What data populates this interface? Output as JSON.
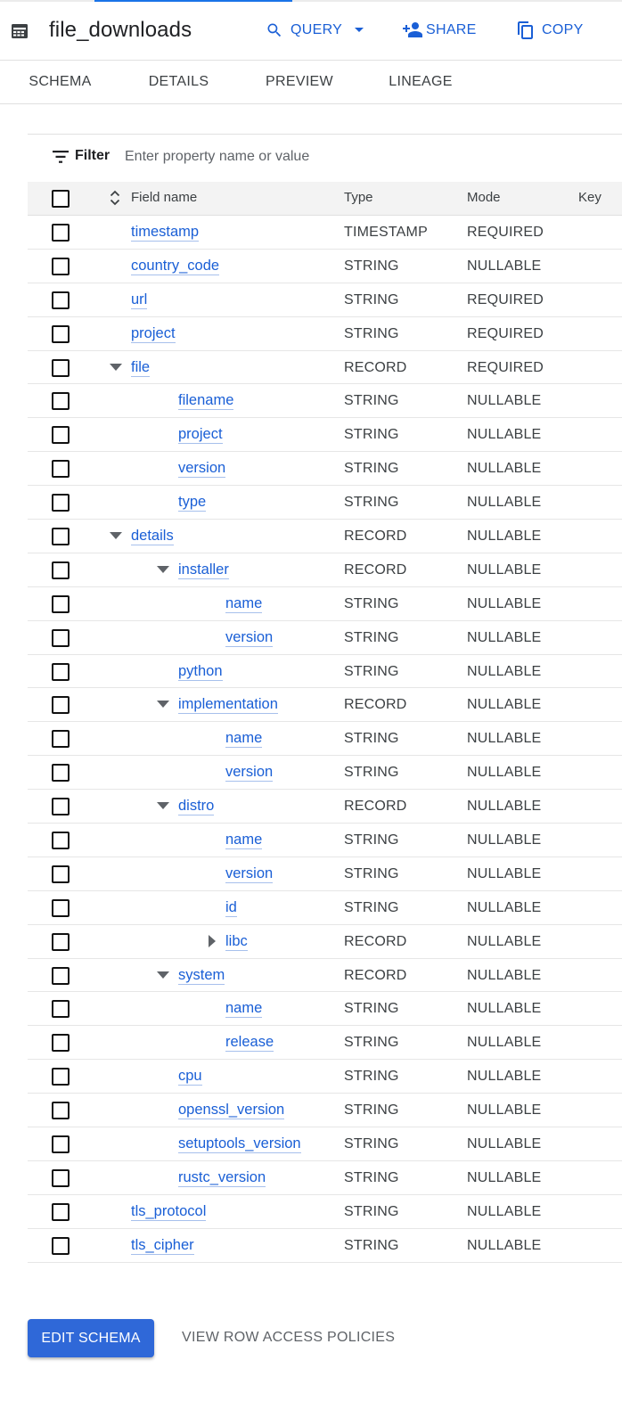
{
  "window": {
    "title": "file_downloads",
    "title_icon": "table-icon"
  },
  "toolbar": {
    "query_label": "QUERY",
    "query_icon": "search-icon",
    "share_label": "SHARE",
    "share_icon": "person-add-icon",
    "copy_label": "COPY",
    "copy_icon": "copy-icon"
  },
  "tabs": [
    {
      "label": "SCHEMA",
      "active": true
    },
    {
      "label": "DETAILS",
      "active": false
    },
    {
      "label": "PREVIEW",
      "active": false
    },
    {
      "label": "LINEAGE",
      "active": false
    }
  ],
  "filter": {
    "label": "Filter",
    "placeholder": "Enter property name or value",
    "value": ""
  },
  "table": {
    "headers": {
      "field_name": "Field name",
      "type": "Type",
      "mode": "Mode",
      "key": "Key"
    },
    "rows": [
      {
        "name": "timestamp",
        "type": "TIMESTAMP",
        "mode": "REQUIRED",
        "level": 0,
        "expander": "none"
      },
      {
        "name": "country_code",
        "type": "STRING",
        "mode": "NULLABLE",
        "level": 0,
        "expander": "none"
      },
      {
        "name": "url",
        "type": "STRING",
        "mode": "REQUIRED",
        "level": 0,
        "expander": "none"
      },
      {
        "name": "project",
        "type": "STRING",
        "mode": "REQUIRED",
        "level": 0,
        "expander": "none"
      },
      {
        "name": "file",
        "type": "RECORD",
        "mode": "REQUIRED",
        "level": 0,
        "expander": "expanded"
      },
      {
        "name": "filename",
        "type": "STRING",
        "mode": "NULLABLE",
        "level": 1,
        "expander": "none"
      },
      {
        "name": "project",
        "type": "STRING",
        "mode": "NULLABLE",
        "level": 1,
        "expander": "none"
      },
      {
        "name": "version",
        "type": "STRING",
        "mode": "NULLABLE",
        "level": 1,
        "expander": "none"
      },
      {
        "name": "type",
        "type": "STRING",
        "mode": "NULLABLE",
        "level": 1,
        "expander": "none"
      },
      {
        "name": "details",
        "type": "RECORD",
        "mode": "NULLABLE",
        "level": 0,
        "expander": "expanded"
      },
      {
        "name": "installer",
        "type": "RECORD",
        "mode": "NULLABLE",
        "level": 1,
        "expander": "expanded"
      },
      {
        "name": "name",
        "type": "STRING",
        "mode": "NULLABLE",
        "level": 2,
        "expander": "none"
      },
      {
        "name": "version",
        "type": "STRING",
        "mode": "NULLABLE",
        "level": 2,
        "expander": "none"
      },
      {
        "name": "python",
        "type": "STRING",
        "mode": "NULLABLE",
        "level": 1,
        "expander": "none"
      },
      {
        "name": "implementation",
        "type": "RECORD",
        "mode": "NULLABLE",
        "level": 1,
        "expander": "expanded"
      },
      {
        "name": "name",
        "type": "STRING",
        "mode": "NULLABLE",
        "level": 2,
        "expander": "none"
      },
      {
        "name": "version",
        "type": "STRING",
        "mode": "NULLABLE",
        "level": 2,
        "expander": "none"
      },
      {
        "name": "distro",
        "type": "RECORD",
        "mode": "NULLABLE",
        "level": 1,
        "expander": "expanded"
      },
      {
        "name": "name",
        "type": "STRING",
        "mode": "NULLABLE",
        "level": 2,
        "expander": "none"
      },
      {
        "name": "version",
        "type": "STRING",
        "mode": "NULLABLE",
        "level": 2,
        "expander": "none"
      },
      {
        "name": "id",
        "type": "STRING",
        "mode": "NULLABLE",
        "level": 2,
        "expander": "none"
      },
      {
        "name": "libc",
        "type": "RECORD",
        "mode": "NULLABLE",
        "level": 2,
        "expander": "collapsed"
      },
      {
        "name": "system",
        "type": "RECORD",
        "mode": "NULLABLE",
        "level": 1,
        "expander": "expanded"
      },
      {
        "name": "name",
        "type": "STRING",
        "mode": "NULLABLE",
        "level": 2,
        "expander": "none"
      },
      {
        "name": "release",
        "type": "STRING",
        "mode": "NULLABLE",
        "level": 2,
        "expander": "none"
      },
      {
        "name": "cpu",
        "type": "STRING",
        "mode": "NULLABLE",
        "level": 1,
        "expander": "none"
      },
      {
        "name": "openssl_version",
        "type": "STRING",
        "mode": "NULLABLE",
        "level": 1,
        "expander": "none"
      },
      {
        "name": "setuptools_version",
        "type": "STRING",
        "mode": "NULLABLE",
        "level": 1,
        "expander": "none"
      },
      {
        "name": "rustc_version",
        "type": "STRING",
        "mode": "NULLABLE",
        "level": 1,
        "expander": "none"
      },
      {
        "name": "tls_protocol",
        "type": "STRING",
        "mode": "NULLABLE",
        "level": 0,
        "expander": "none"
      },
      {
        "name": "tls_cipher",
        "type": "STRING",
        "mode": "NULLABLE",
        "level": 0,
        "expander": "none"
      }
    ]
  },
  "footer": {
    "edit_schema_label": "EDIT SCHEMA",
    "row_access_label": "VIEW ROW ACCESS POLICIES"
  },
  "colors": {
    "accent": "#1a5fd6",
    "primary_button": "#2f68d8",
    "header_bg": "#f3f3f3"
  }
}
